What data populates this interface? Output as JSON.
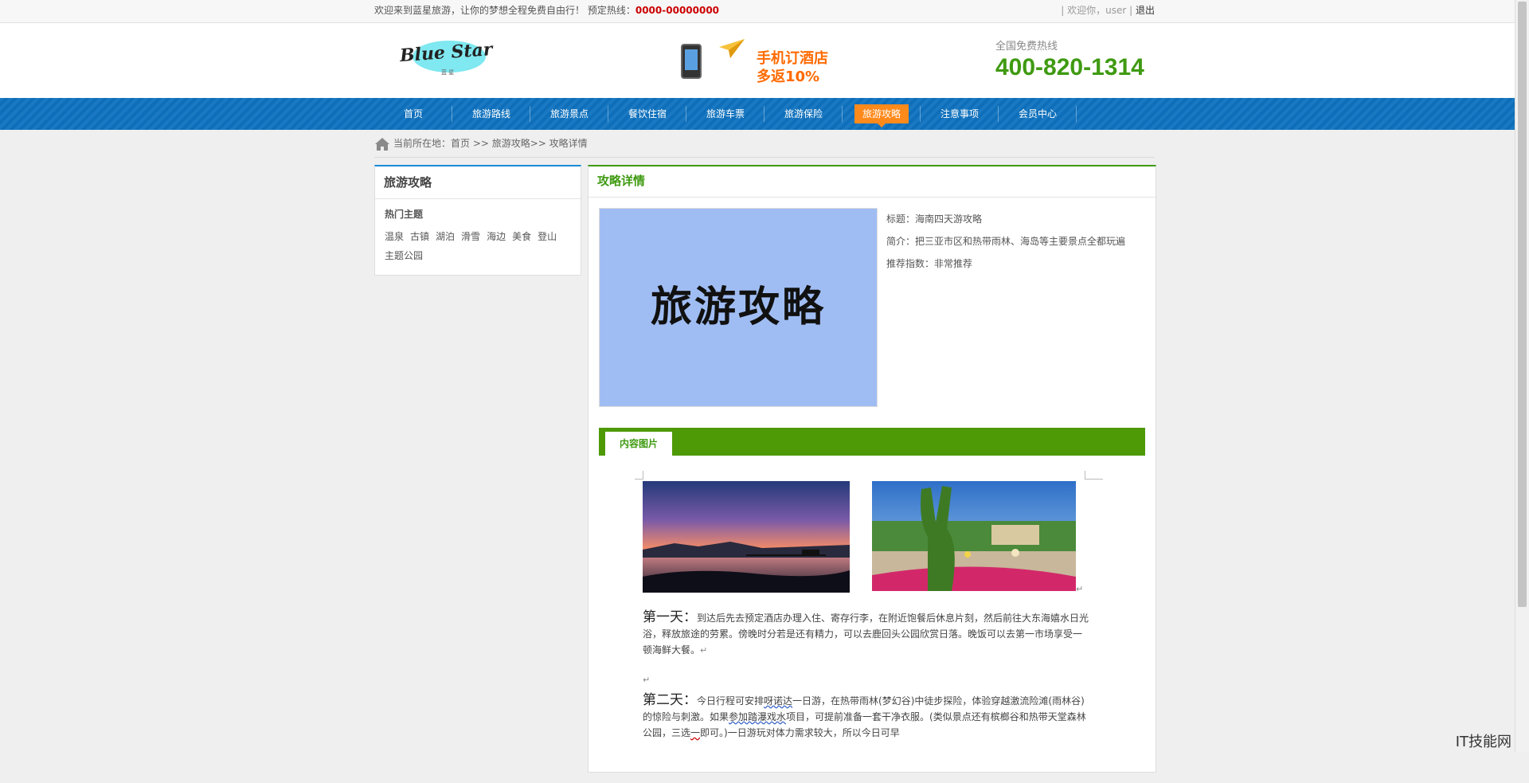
{
  "topbar": {
    "welcome": "欢迎来到蓝星旅游，让你的梦想全程免费自由行！",
    "hotline_label": "预定热线：",
    "hotline_number": "0000-00000000",
    "user_prefix": "| 欢迎你，",
    "user_name": "user",
    "user_sep": " |",
    "logout": "退出"
  },
  "header": {
    "logo_text": "Blue Star",
    "logo_sub": "蓝星",
    "promo_line1": "手机订酒店",
    "promo_line2": "多返10%",
    "hotline_label": "全国免费热线",
    "hotline_number": "400-820-1314"
  },
  "nav": {
    "items": [
      {
        "label": "首页"
      },
      {
        "label": "旅游路线"
      },
      {
        "label": "旅游景点"
      },
      {
        "label": "餐饮住宿"
      },
      {
        "label": "旅游车票"
      },
      {
        "label": "旅游保险"
      },
      {
        "label": "旅游攻略"
      },
      {
        "label": "注意事项"
      },
      {
        "label": "会员中心"
      }
    ],
    "active_index": 6
  },
  "breadcrumb": {
    "text": "当前所在地：首页 >> 旅游攻略>> 攻略详情"
  },
  "sidebar": {
    "title": "旅游攻略",
    "subtitle": "热门主题",
    "tags": [
      "温泉",
      "古镇",
      "湖泊",
      "滑雪",
      "海边",
      "美食",
      "登山",
      "主题公园"
    ]
  },
  "main": {
    "title": "攻略详情",
    "cover_text": "旅游攻略",
    "info_title": "标题：海南四天游攻略",
    "info_intro": "简介：把三亚市区和热带雨林、海岛等主要景点全都玩遍",
    "info_rating": "推荐指数：非常推荐",
    "tab_label": "内容图片",
    "day1_head": "第一天：",
    "day1_text_a": "到达后先去预定酒店办理入住、寄存行李，在附近饱餐后休息片刻，然后前往大东海嬉水日光浴，释放旅途的劳累。傍晚时分若是还有精力，可以去鹿回头公园欣赏日落。晚饭可以去第一市场享受一顿海鲜大餐。",
    "day2_head": "第二天：",
    "day2_text_a": "今日行程可安排",
    "day2_link1": "呀诺达",
    "day2_text_b": "一日游，在热带雨林(梦幻谷)中徒步探险，体验穿越激流险滩(雨林谷)的惊险与刺激。如果",
    "day2_link2": "参加踏瀑戏水",
    "day2_text_c": "项目，可提前准备一套干净衣服。(类似景点还有槟榔谷和热带天堂森林公园，三选",
    "day2_link3": "一",
    "day2_text_d": "即可。)一日游玩对体力需求较大，所以今日可早"
  },
  "watermark": "IT技能网"
}
